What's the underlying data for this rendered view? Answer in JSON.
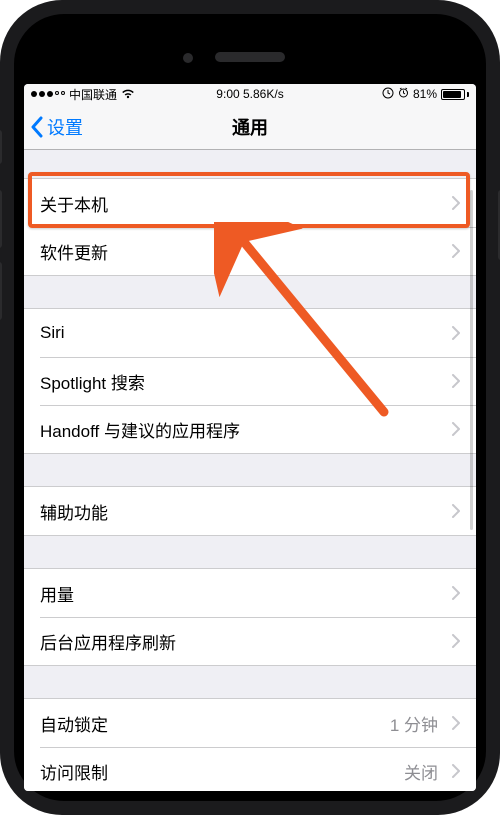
{
  "status": {
    "carrier": "中国联通",
    "time_speed": "9:00 5.86K/s",
    "battery_pct": "81%",
    "battery_fill_pct": 81
  },
  "nav": {
    "back_label": "设置",
    "title": "通用"
  },
  "groups": [
    {
      "rows": [
        {
          "label": "关于本机",
          "value": ""
        },
        {
          "label": "软件更新",
          "value": ""
        }
      ]
    },
    {
      "rows": [
        {
          "label": "Siri",
          "value": ""
        },
        {
          "label": "Spotlight 搜索",
          "value": ""
        },
        {
          "label": "Handoff 与建议的应用程序",
          "value": ""
        }
      ]
    },
    {
      "rows": [
        {
          "label": "辅助功能",
          "value": ""
        }
      ]
    },
    {
      "rows": [
        {
          "label": "用量",
          "value": ""
        },
        {
          "label": "后台应用程序刷新",
          "value": ""
        }
      ]
    },
    {
      "rows": [
        {
          "label": "自动锁定",
          "value": "1 分钟"
        },
        {
          "label": "访问限制",
          "value": "关闭"
        }
      ]
    }
  ],
  "annotation": {
    "highlight_color": "#ee5a24",
    "arrow_color": "#ee5a24"
  }
}
